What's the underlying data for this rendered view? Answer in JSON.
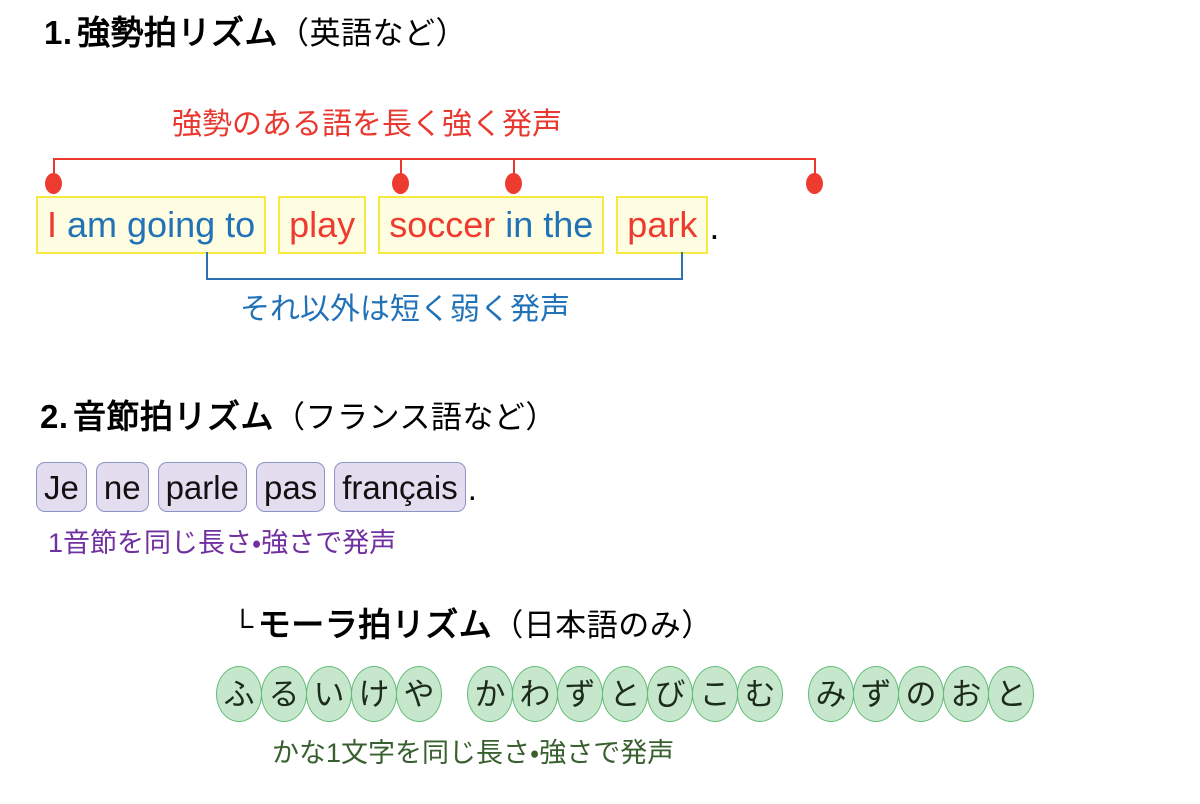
{
  "sections": {
    "stress": {
      "heading": {
        "number": "1.",
        "title": "強勢拍リズム",
        "paren": "（英語など）"
      },
      "top_note": "強勢のある語を長く強く発声",
      "bottom_note": "それ以外は短く弱く発声",
      "note_colors": {
        "stressed": "#e8382f",
        "weak": "#2272b8"
      },
      "box_style": {
        "fill": "#fefce1",
        "border": "#f7e93f"
      },
      "phrase_boxes": [
        {
          "words": [
            {
              "text": "I",
              "emphasis": "stressed"
            },
            {
              "text": "am going to",
              "emphasis": "weak"
            }
          ]
        },
        {
          "words": [
            {
              "text": "play",
              "emphasis": "stressed"
            }
          ]
        },
        {
          "words": [
            {
              "text": "soccer",
              "emphasis": "stressed"
            },
            {
              "text": "in the",
              "emphasis": "weak"
            }
          ]
        },
        {
          "words": [
            {
              "text": "park",
              "emphasis": "stressed"
            }
          ]
        }
      ],
      "terminal_punctuation": "."
    },
    "syllable": {
      "heading": {
        "number": "2.",
        "title": "音節拍リズム",
        "paren": "（フランス語など）"
      },
      "note": "1音節を同じ長さ・強さで発声",
      "note_color": "#7030a0",
      "box_style": {
        "fill": "#e4dcef",
        "border": "#8b96c5"
      },
      "syllables": [
        "Je",
        "ne",
        "parle",
        "pas",
        "français"
      ],
      "terminal_punctuation": "."
    },
    "mora": {
      "heading": {
        "corner": "└",
        "title": "モーラ拍リズム",
        "paren": "（日本語のみ）"
      },
      "note": "かな1文字を同じ長さ・強さで発声",
      "note_color": "#38602f",
      "cell_style": {
        "fill": "#c6e7cb",
        "border": "#63bb78"
      },
      "groups": [
        [
          "ふ",
          "る",
          "い",
          "け",
          "や"
        ],
        [
          "か",
          "わ",
          "ず",
          "と",
          "び",
          "こ",
          "む"
        ],
        [
          "み",
          "ず",
          "の",
          "お",
          "と"
        ]
      ]
    }
  }
}
